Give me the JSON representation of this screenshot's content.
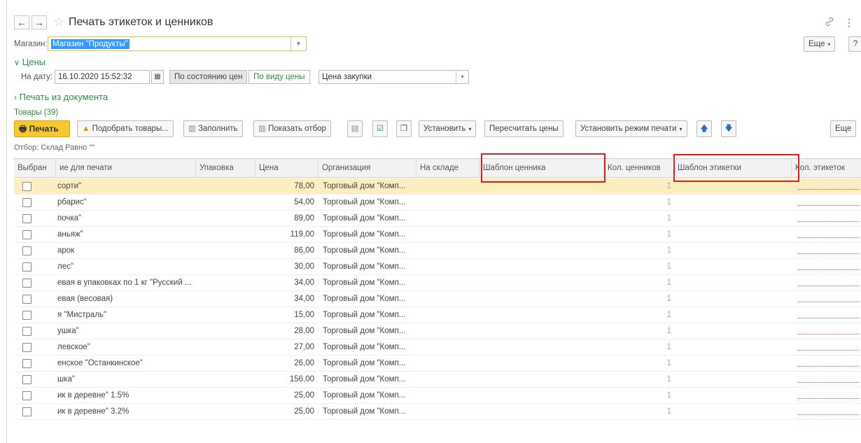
{
  "window": {
    "title": "Печать этикеток и ценников",
    "back_icon": "←",
    "forward_icon": "→",
    "star_icon": "☆"
  },
  "store": {
    "label": "Магазин:",
    "value": "Магазин \"Продукты\""
  },
  "header_buttons": {
    "more": "Еще",
    "help": "?"
  },
  "prices_section": {
    "title": "Цены",
    "date_label": "На дату:",
    "date_value": "16.10.2020 15:52:32",
    "by_state": "По состоянию цен",
    "by_type": "По виду цены",
    "price_type": "Цена закупки"
  },
  "print_from_doc": {
    "title": "Печать из документа"
  },
  "goods": {
    "count_label": "Товары (39)",
    "filter": "Отбор: Склад Равно \"\""
  },
  "toolbar": {
    "print": "Печать",
    "pick_goods": "Подобрать товары...",
    "fill": "Заполнить",
    "show_filter": "Показать отбор",
    "set": "Установить",
    "recalc": "Пересчитать цены",
    "set_mode": "Установить режим печати",
    "more": "Еще"
  },
  "table": {
    "columns": {
      "selected": "Выбран",
      "name": "ие для печати",
      "pack": "Упаковка",
      "price": "Цена",
      "org": "Организация",
      "stock": "На складе",
      "price_tpl": "Шаблон ценника",
      "price_qty": "Кол. ценников",
      "label_tpl": "Шаблон этикетки",
      "label_qty": "Кол. этикеток"
    },
    "rows": [
      {
        "name": "сорти\"",
        "price": "78,00",
        "org": "Торговый дом \"Комп...",
        "qty": "1"
      },
      {
        "name": "рбарис\"",
        "price": "54,00",
        "org": "Торговый дом \"Комп...",
        "qty": "1"
      },
      {
        "name": "почка\"",
        "price": "89,00",
        "org": "Торговый дом \"Комп...",
        "qty": "1"
      },
      {
        "name": "аньяж\"",
        "price": "119,00",
        "org": "Торговый дом \"Комп...",
        "qty": "1"
      },
      {
        "name": "арок",
        "price": "86,00",
        "org": "Торговый дом \"Комп...",
        "qty": "1"
      },
      {
        "name": "лес\"",
        "price": "30,00",
        "org": "Торговый дом \"Комп...",
        "qty": "1"
      },
      {
        "name": "евая в упаковках по 1 кг \"Русский ...",
        "price": "34,00",
        "org": "Торговый дом \"Комп...",
        "qty": "1"
      },
      {
        "name": "евая (весовая)",
        "price": "34,00",
        "org": "Торговый дом \"Комп...",
        "qty": "1"
      },
      {
        "name": "я \"Мистраль\"",
        "price": "15,00",
        "org": "Торговый дом \"Комп...",
        "qty": "1"
      },
      {
        "name": "ушка\"",
        "price": "28,00",
        "org": "Торговый дом \"Комп...",
        "qty": "1"
      },
      {
        "name": "левское\"",
        "price": "27,00",
        "org": "Торговый дом \"Комп...",
        "qty": "1"
      },
      {
        "name": "енское \"Останкинское\"",
        "price": "26,00",
        "org": "Торговый дом \"Комп...",
        "qty": "1"
      },
      {
        "name": "шка\"",
        "price": "156,00",
        "org": "Торговый дом \"Комп...",
        "qty": "1"
      },
      {
        "name": "ик в деревне\" 1.5%",
        "price": "25,00",
        "org": "Торговый дом \"Комп...",
        "qty": "1"
      },
      {
        "name": "ик в деревне\" 3.2%",
        "price": "25,00",
        "org": "Торговый дом \"Комп...",
        "qty": "1"
      }
    ]
  },
  "colors": {
    "accent_yellow": "#f5c830",
    "link_green": "#2f8f4b",
    "highlight_red": "#e02020",
    "selected_row": "#fbeec0"
  }
}
